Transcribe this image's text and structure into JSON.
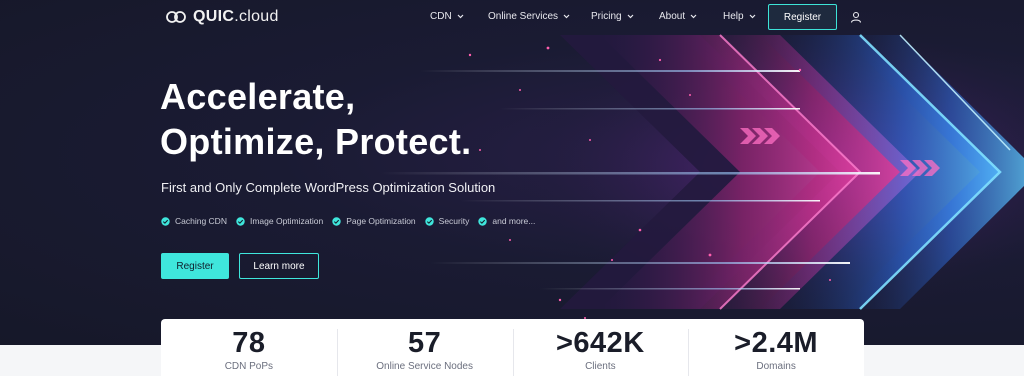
{
  "header": {
    "logo_text_bold": "QUIC",
    "logo_text_rest": ".cloud",
    "nav": [
      {
        "label": "CDN",
        "has_dropdown": true
      },
      {
        "label": "Online Services",
        "has_dropdown": true
      },
      {
        "label": "Pricing",
        "has_dropdown": true
      },
      {
        "label": "About",
        "has_dropdown": true
      },
      {
        "label": "Help",
        "has_dropdown": true
      }
    ],
    "register_label": "Register",
    "user_icon": "user-icon"
  },
  "hero": {
    "headline_line1": "Accelerate,",
    "headline_line2": "Optimize, Protect.",
    "subheadline": "First and Only Complete WordPress Optimization Solution",
    "features": [
      "Caching CDN",
      "Image Optimization",
      "Page Optimization",
      "Security",
      "and more..."
    ],
    "primary_button": "Register",
    "secondary_button": "Learn more"
  },
  "stats": [
    {
      "value": "78",
      "label": "CDN PoPs"
    },
    {
      "value": "57",
      "label": "Online Service Nodes"
    },
    {
      "value": ">642K",
      "label": "Clients"
    },
    {
      "value": ">2.4M",
      "label": "Domains"
    }
  ],
  "colors": {
    "accent": "#3fe6dc",
    "background": "#16192a",
    "magenta": "#e0359a",
    "blue": "#2f8fff"
  }
}
